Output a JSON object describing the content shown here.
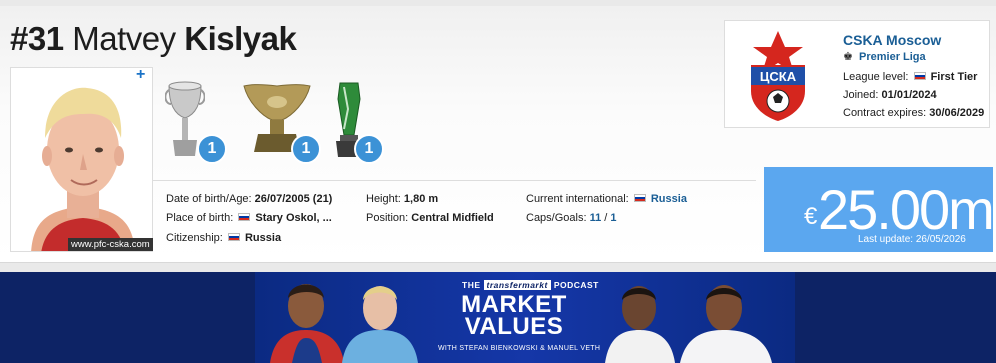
{
  "player": {
    "number": "#31",
    "first_name": "Matvey",
    "last_name": "Kislyak",
    "photo_credit": "www.pfc-cska.com"
  },
  "trophies": [
    {
      "name": "cup-trophy",
      "count": "1"
    },
    {
      "name": "supercup-trophy",
      "count": "1"
    },
    {
      "name": "league-cup-trophy",
      "count": "1"
    }
  ],
  "club": {
    "name": "CSKA Moscow",
    "league": "Premier Liga",
    "league_level_label": "League level:",
    "league_level_value": "First Tier",
    "joined_label": "Joined:",
    "joined_value": "01/01/2024",
    "contract_label": "Contract expires:",
    "contract_value": "30/06/2029"
  },
  "info": {
    "dob_label": "Date of birth/Age:",
    "dob_value": "26/07/2005 (21)",
    "pob_label": "Place of birth:",
    "pob_value": "Stary Oskol, ...",
    "citizenship_label": "Citizenship:",
    "citizenship_value": "Russia",
    "height_label": "Height:",
    "height_value": "1,80 m",
    "position_label": "Position:",
    "position_value": "Central Midfield",
    "intl_label": "Current international:",
    "intl_value": "Russia",
    "caps_label": "Caps/Goals:",
    "caps_value": "11",
    "caps_sep": " / ",
    "goals_value": "1"
  },
  "market_value": {
    "currency": "€",
    "value": "25.00m",
    "last_update": "Last update: 26/05/2026"
  },
  "banner": {
    "the": "THE",
    "brand": "transfermarkt",
    "podcast": "PODCAST",
    "title_line1": "MARKET",
    "title_line2": "VALUES",
    "subtitle": "WITH STEFAN BIENKOWSKI & MANUEL VETH"
  },
  "colors": {
    "accent": "#1a5e95",
    "market_value_bg": "#5ba7ef",
    "badge_blue": "#3c92d6",
    "banner_bg": "#0d2365",
    "club_red": "#d5261e"
  }
}
